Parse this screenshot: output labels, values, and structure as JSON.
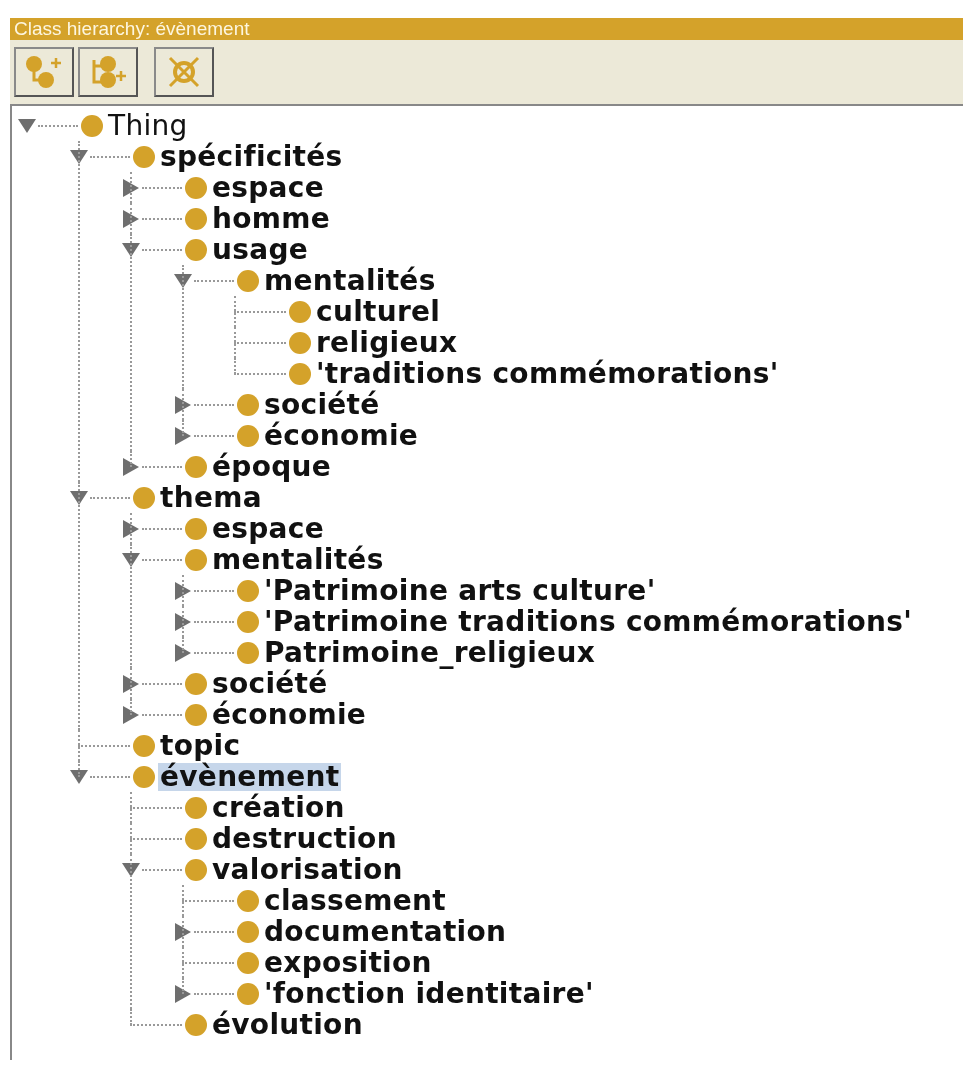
{
  "panel": {
    "title": "Class hierarchy: évènement"
  },
  "toolbar": [
    {
      "kind": "add-subclass"
    },
    {
      "kind": "add-sibling"
    },
    {
      "kind": "delete"
    }
  ],
  "tree": [
    {
      "label": "Thing",
      "kind": "branch",
      "expanded": true,
      "bold": false,
      "selected": false,
      "children": [
        {
          "label": "spécificités",
          "kind": "branch",
          "expanded": true,
          "bold": true,
          "selected": false,
          "children": [
            {
              "label": "espace",
              "kind": "branch",
              "expanded": false,
              "bold": true,
              "selected": false
            },
            {
              "label": "homme",
              "kind": "branch",
              "expanded": false,
              "bold": true,
              "selected": false
            },
            {
              "label": "usage",
              "kind": "branch",
              "expanded": true,
              "bold": true,
              "selected": false,
              "children": [
                {
                  "label": "mentalités",
                  "kind": "branch",
                  "expanded": true,
                  "bold": true,
                  "selected": false,
                  "children": [
                    {
                      "label": "culturel",
                      "kind": "leaf",
                      "bold": true,
                      "selected": false
                    },
                    {
                      "label": "religieux",
                      "kind": "leaf",
                      "bold": true,
                      "selected": false
                    },
                    {
                      "label": "'traditions commémorations'",
                      "kind": "leaf",
                      "bold": true,
                      "selected": false
                    }
                  ]
                },
                {
                  "label": "société",
                  "kind": "branch",
                  "expanded": false,
                  "bold": true,
                  "selected": false
                },
                {
                  "label": "économie",
                  "kind": "branch",
                  "expanded": false,
                  "bold": true,
                  "selected": false
                }
              ]
            },
            {
              "label": "époque",
              "kind": "branch",
              "expanded": false,
              "bold": true,
              "selected": false
            }
          ]
        },
        {
          "label": "thema",
          "kind": "branch",
          "expanded": true,
          "bold": true,
          "selected": false,
          "children": [
            {
              "label": "espace",
              "kind": "branch",
              "expanded": false,
              "bold": true,
              "selected": false
            },
            {
              "label": "mentalités",
              "kind": "branch",
              "expanded": true,
              "bold": true,
              "selected": false,
              "children": [
                {
                  "label": "'Patrimoine arts culture'",
                  "kind": "branch",
                  "expanded": false,
                  "bold": true,
                  "selected": false
                },
                {
                  "label": "'Patrimoine traditions commémorations'",
                  "kind": "branch",
                  "expanded": false,
                  "bold": true,
                  "selected": false
                },
                {
                  "label": "Patrimoine_religieux",
                  "kind": "branch",
                  "expanded": false,
                  "bold": true,
                  "selected": false
                }
              ]
            },
            {
              "label": "société",
              "kind": "branch",
              "expanded": false,
              "bold": true,
              "selected": false
            },
            {
              "label": "économie",
              "kind": "branch",
              "expanded": false,
              "bold": true,
              "selected": false
            }
          ]
        },
        {
          "label": "topic",
          "kind": "leaf",
          "bold": true,
          "selected": false
        },
        {
          "label": "évènement",
          "kind": "branch",
          "expanded": true,
          "bold": true,
          "selected": true,
          "children": [
            {
              "label": "création",
              "kind": "leaf",
              "bold": true,
              "selected": false
            },
            {
              "label": "destruction",
              "kind": "leaf",
              "bold": true,
              "selected": false
            },
            {
              "label": "valorisation",
              "kind": "branch",
              "expanded": true,
              "bold": true,
              "selected": false,
              "children": [
                {
                  "label": "classement",
                  "kind": "leaf",
                  "bold": true,
                  "selected": false
                },
                {
                  "label": "documentation",
                  "kind": "branch",
                  "expanded": false,
                  "bold": true,
                  "selected": false
                },
                {
                  "label": "exposition",
                  "kind": "leaf",
                  "bold": true,
                  "selected": false
                },
                {
                  "label": "'fonction identitaire'",
                  "kind": "branch",
                  "expanded": false,
                  "bold": true,
                  "selected": false
                }
              ]
            },
            {
              "label": "évolution",
              "kind": "leaf",
              "bold": true,
              "selected": false
            }
          ]
        }
      ]
    }
  ]
}
